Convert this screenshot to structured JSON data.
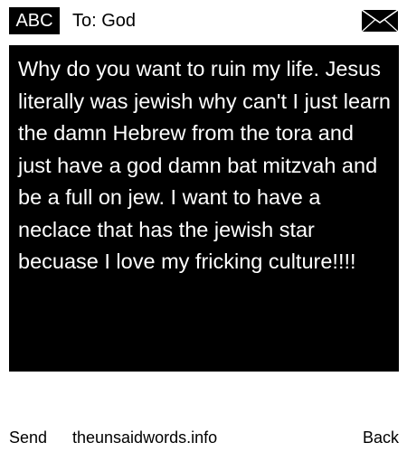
{
  "header": {
    "mode_label": "ABC",
    "recipient": "To: God",
    "envelope_icon": "envelope-icon"
  },
  "message": {
    "text": "Why do you want to ruin my life. Jesus literally was jewish why can't I just learn the damn Hebrew from the tora and just have a god damn bat mitzvah and be a full on jew. I want to have a neclace that has the jewish star becuase I love my fricking culture!!!!"
  },
  "footer": {
    "send_label": "Send",
    "site_label": "theunsaidwords.info",
    "back_label": "Back"
  },
  "colors": {
    "background": "#ffffff",
    "message_box": "#000000",
    "message_text": "#ffffff",
    "foreground": "#000000"
  }
}
